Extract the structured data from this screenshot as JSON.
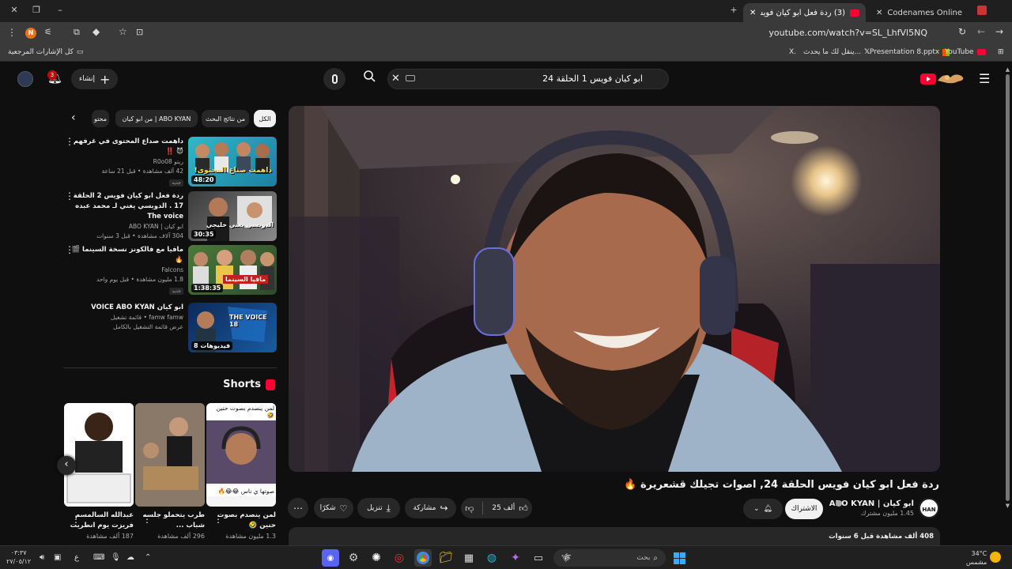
{
  "browser": {
    "tabs": [
      {
        "title": "Codenames Online",
        "active": false
      },
      {
        "title": "(3) ردة فعل ابو كيان فويس الحلقة",
        "active": true
      }
    ],
    "new_tab": "+",
    "url": "youtube.com/watch?v=SL_LhfVl5NQ",
    "profile_initial": "N",
    "bookmarks": [
      {
        "label": "YouTube",
        "icon": "youtube-icon"
      },
      {
        "label": "Presentation 8.pptx",
        "icon": "office-icon"
      },
      {
        "label": "ينقل لك ما يحدث...",
        "icon": "x-icon"
      },
      {
        "label": "X.",
        "icon": ""
      }
    ],
    "all_bookmarks": "كل الإشارات المرجعية"
  },
  "youtube": {
    "search_query": "ابو كيان فويس 1 الحلقة 24",
    "search_placeholder": "بحث",
    "create_label": "إنشاء",
    "notifications_count": "3"
  },
  "filters": {
    "chips": [
      {
        "label": "الكل",
        "active": true
      },
      {
        "label": "من نتائج البحث",
        "active": false
      },
      {
        "label": "من ابو كيان | ABO KYAN",
        "active": false
      },
      {
        "label": "محتو",
        "active": false
      }
    ]
  },
  "recommendations": [
    {
      "title": "داهمت صداع المحتوى في غرفهم 😈 ‼️",
      "channel": "ريتو R0o08",
      "meta": "42 ألف مشاهدة • قبل 21 ساعة",
      "badge": "جديد",
      "duration": "48:20",
      "thumb_text": "داهمت صناع المحتوى!"
    },
    {
      "title": "ردة فعل ابو كيان فويس 2 الحلقة 17 . الدويسي يغني لـ محمد عبده The voice",
      "channel": "ابو كيان | ABO KYAN",
      "meta": "304 آلاف مشاهدة • قبل 3 سنوات",
      "badge": "",
      "duration": "30:35",
      "thumb_text": "الدويسي يغني خليجي"
    },
    {
      "title": "مافيا مع فالكونز نسخة السينما 🎬 🔥",
      "channel": "Falcons",
      "meta": "1.8 مليون مشاهدة • قبل يوم واحد",
      "badge": "جديد",
      "duration": "1:38:35",
      "thumb_text": "مافيا السينما"
    },
    {
      "title": "ابو كيان VOICE ABO KYAN",
      "channel": "famw famw • قائمة تشغيل",
      "meta": "عرض قائمة التشغيل بالكامل",
      "badge": "",
      "duration": "8 فيديوهات",
      "thumb_text": "THE VOICE 18"
    }
  ],
  "shorts": {
    "heading": "Shorts",
    "items": [
      {
        "title": "لمن ينصدم بصوت حنين 🤣",
        "views": "1.3 مليون مشاهدة",
        "overlay": "صوتها ي ناس 😂😂🔥"
      },
      {
        "title": "طرب يتحملو جلسه شباب ...",
        "views": "296 ألف مشاهدة",
        "overlay": ""
      },
      {
        "title": "عبدالله السالمسم فريزت يوم انطريت",
        "views": "187 ألف مشاهدة",
        "overlay": ""
      }
    ]
  },
  "video": {
    "title": "ردة فعل ابو كيان فويس الحلقة 24, اصوات تجيلك قشعريرة 🔥",
    "channel_name": "ابو كيان | ABO KYAN",
    "subscribers": "1.45 مليون مشترك",
    "channel_avatar": "HAN",
    "subscribe_label": "الاشتراك",
    "likes": "25 ألف",
    "share_label": "مشاركة",
    "download_label": "تنزيل",
    "thanks_label": "شكرًا",
    "description_meta": "408 ألف مشاهدة قبل 6 سنوات"
  },
  "taskbar": {
    "search_placeholder": "بحث",
    "time": "٠٣:٣٧",
    "date": "٢٧/٠٥/١٢",
    "weather_temp": "34°C",
    "weather_desc": "مشمس",
    "lang": "ع"
  },
  "colors": {
    "youtube_red": "#ff0033",
    "bg": "#0f0f0f",
    "chip_bg": "#272727"
  }
}
